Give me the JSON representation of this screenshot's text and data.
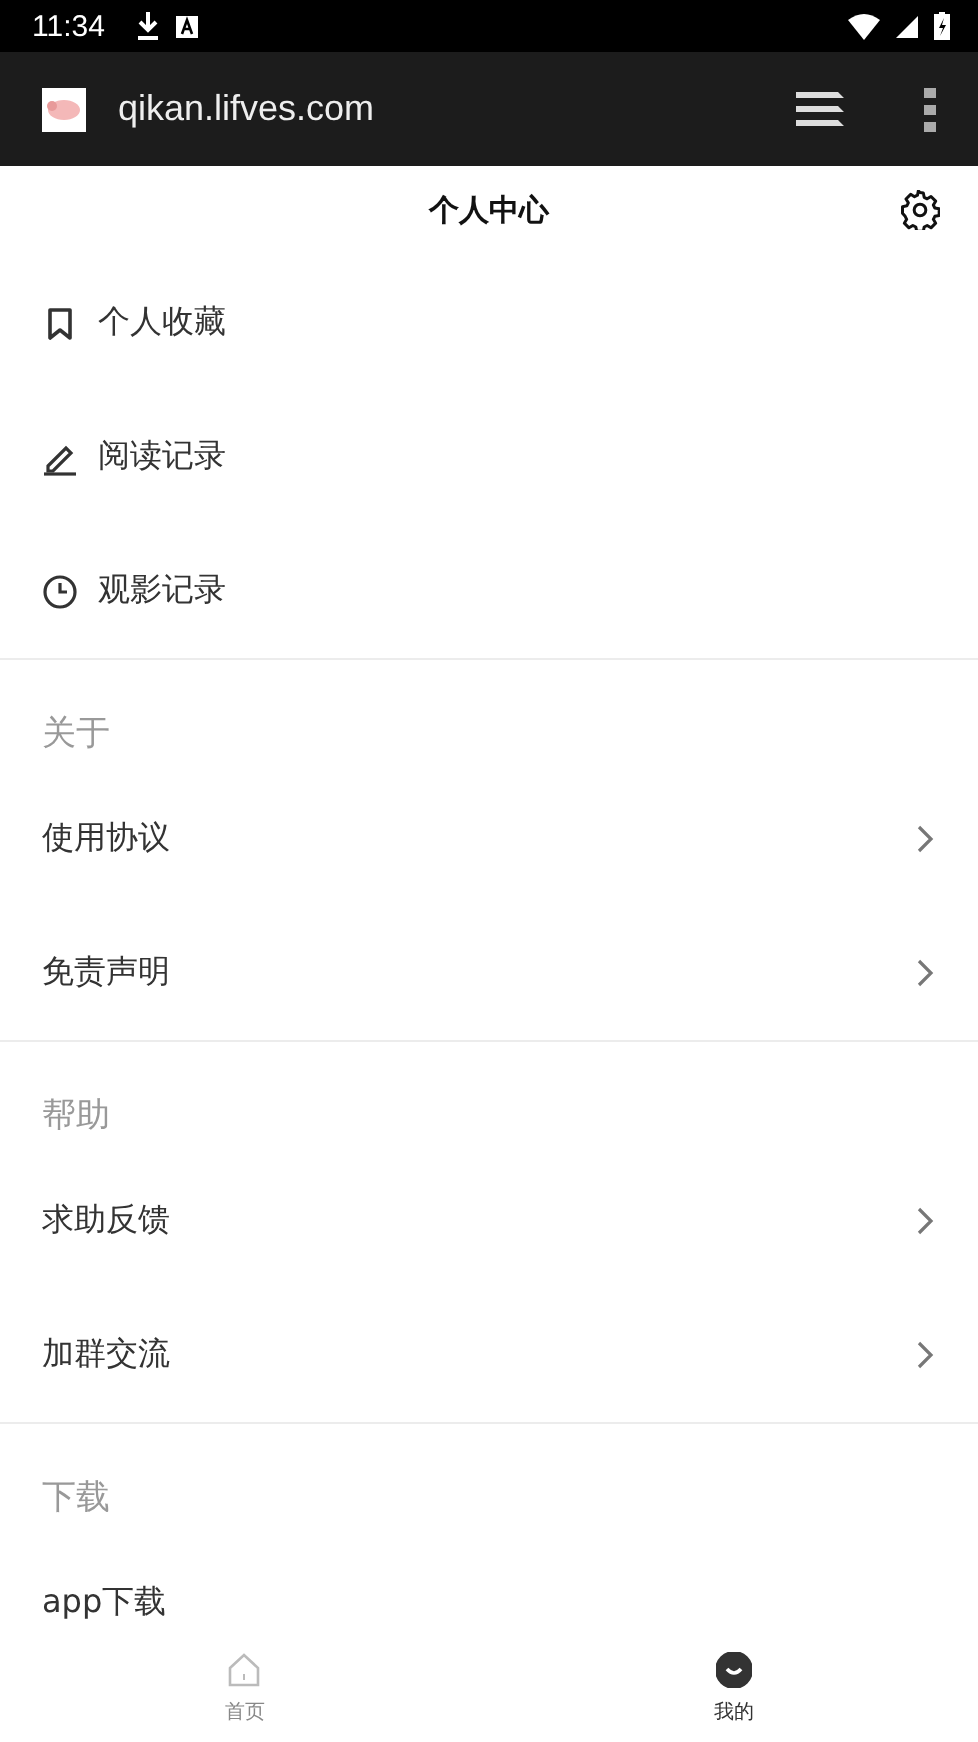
{
  "status_bar": {
    "time": "11:34"
  },
  "browser": {
    "url": "qikan.lifves.com"
  },
  "header": {
    "title": "个人中心"
  },
  "quick_items": [
    {
      "label": "个人收藏"
    },
    {
      "label": "阅读记录"
    },
    {
      "label": "观影记录"
    }
  ],
  "sections": [
    {
      "title": "关于",
      "items": [
        {
          "label": "使用协议",
          "chevron": true
        },
        {
          "label": "免责声明",
          "chevron": true
        }
      ]
    },
    {
      "title": "帮助",
      "items": [
        {
          "label": "求助反馈",
          "chevron": true
        },
        {
          "label": "加群交流",
          "chevron": true
        }
      ]
    },
    {
      "title": "下载",
      "items": [
        {
          "label": "app下载",
          "chevron": false
        }
      ]
    }
  ],
  "tab_bar": [
    {
      "label": "首页",
      "selected": false
    },
    {
      "label": "我的",
      "selected": true
    }
  ]
}
